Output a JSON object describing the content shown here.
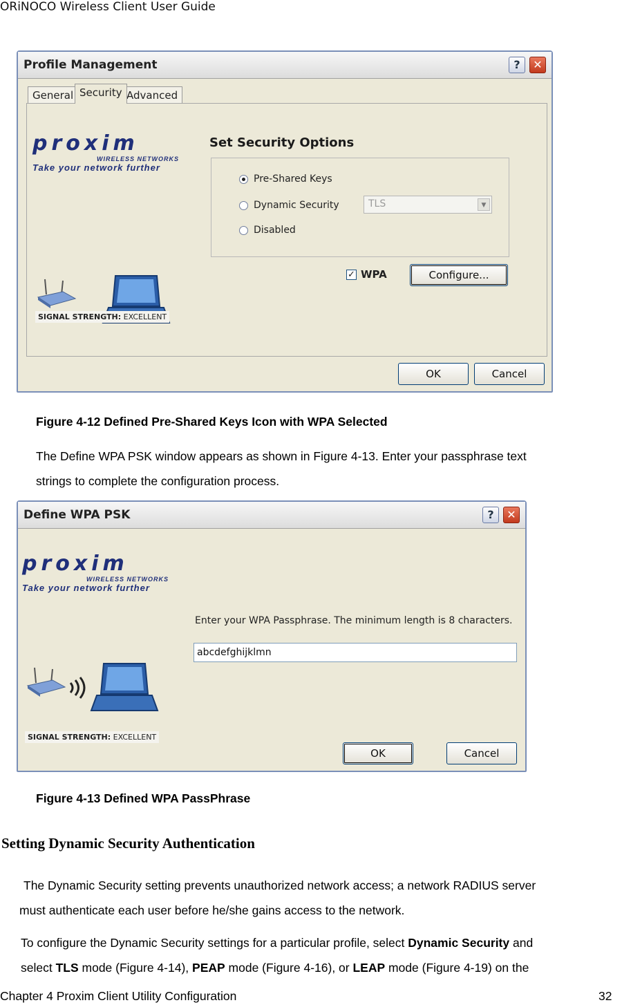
{
  "header": {
    "title": "ORiNOCO Wireless Client User Guide"
  },
  "figure1": {
    "window_title": "Profile Management",
    "tabs": [
      "General",
      "Security",
      "Advanced"
    ],
    "logo": {
      "brand": "proxim",
      "subtitle": "WIRELESS NETWORKS",
      "tagline": "Take your network further"
    },
    "signal": {
      "label": "SIGNAL STRENGTH:",
      "value": "EXCELLENT"
    },
    "section_title": "Set Security Options",
    "options": [
      "Pre-Shared Keys",
      "Dynamic Security",
      "Disabled"
    ],
    "selected_option": "Pre-Shared Keys",
    "dropdown_value": "TLS",
    "wpa_label": "WPA",
    "wpa_checked": true,
    "configure_label": "Configure...",
    "ok_label": "OK",
    "cancel_label": "Cancel",
    "help_glyph": "?",
    "close_glyph": "✕",
    "caption": "Figure 4-12  Defined Pre-Shared Keys Icon with WPA Selected"
  },
  "paragraph1": [
    "The Define WPA PSK window appears as shown in Figure 4-13. Enter your passphrase text",
    "strings to complete the configuration process."
  ],
  "figure2": {
    "window_title": "Define WPA PSK",
    "logo": {
      "brand": "proxim",
      "subtitle": "WIRELESS NETWORKS",
      "tagline": "Take your network further"
    },
    "signal": {
      "label": "SIGNAL STRENGTH:",
      "value": "EXCELLENT"
    },
    "prompt": "Enter your WPA Passphrase.  The minimum length is 8 characters.",
    "passphrase_value": "abcdefghijklmn",
    "ok_label": "OK",
    "cancel_label": "Cancel",
    "help_glyph": "?",
    "close_glyph": "✕",
    "caption": "Figure 4-13  Defined WPA PassPhrase"
  },
  "section_heading": "Setting Dynamic Security Authentication",
  "paragraph2": [
    "The Dynamic Security setting prevents unauthorized network access; a network RADIUS server",
    "must authenticate each user before he/she gains access to the network."
  ],
  "paragraph3": {
    "line1_pre": "To configure the Dynamic Security settings for a particular profile, select ",
    "line1_bold": "Dynamic Security",
    "line1_post": " and",
    "line2_a": "select ",
    "line2_b": "TLS",
    "line2_c": " mode (Figure 4-14), ",
    "line2_d": "PEAP",
    "line2_e": " mode (Figure 4-16), or ",
    "line2_f": "LEAP",
    "line2_g": " mode (Figure 4-19) on the"
  },
  "footer": {
    "chapter": "Chapter 4 Proxim Client Utility Configuration",
    "page": "32"
  }
}
